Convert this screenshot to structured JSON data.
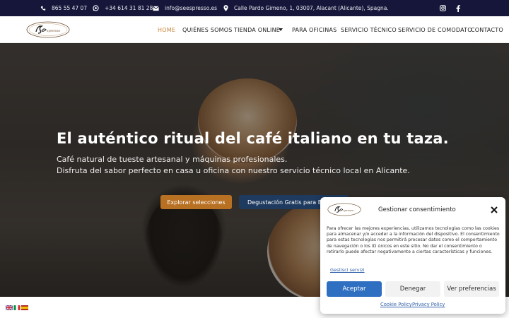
{
  "topbar": {
    "phone": "865 55 47 07",
    "whatsapp": "+34 614 31 81 28",
    "email": "info@seespresso.es",
    "address": "Calle Pardo Gimeno, 1, 03007, Alacant (Alicante), Spagna.",
    "social_icons": [
      "instagram-icon",
      "facebook-icon"
    ]
  },
  "nav": {
    "logo_text": "See spresso",
    "items": [
      {
        "label": "HOME",
        "active": true
      },
      {
        "label": "QUIÉNES SOMOS"
      },
      {
        "label": "TIENDA ONLINE"
      },
      {
        "label": "PARA OFICINAS"
      },
      {
        "label": "SERVICIO TÉCNICO"
      },
      {
        "label": "SERVICIO DE COMODATO"
      },
      {
        "label": "CONTACTO"
      }
    ]
  },
  "hero": {
    "headline": "El auténtico ritual del café italiano en tu taza.",
    "line1": "Café natural de tueste artesanal y máquinas profesionales.",
    "line2": "Disfruta del sabor perfecto en casa u oficina con nuestro servicio técnico local en Alicante.",
    "btn_primary": "Explorar selecciones",
    "btn_secondary": "Degustación Gratis para Empresas"
  },
  "languages": [
    "en",
    "it",
    "es"
  ],
  "consent": {
    "title": "Gestionar consentimiento",
    "text": "Para ofrecer las mejores experiencias, utilizamos tecnologías como las cookies para almacenar y/o acceder a la información del dispositivo. El consentimiento para estas tecnologías nos permitirá procesar datos como el comportamiento de navegación o los ID únicos en este sitio. No dar el consentimiento o retirarlo puede afectar negativamente a ciertas características y funciones.",
    "manage_link": "Gestisci servizi",
    "accept": "Aceptar",
    "deny": "Denegar",
    "preferences": "Ver preferencias",
    "cookie_policy": "Cookie Policy",
    "privacy_policy": "Privacy Policy"
  },
  "colors": {
    "topbar_bg": "#16163a",
    "accent": "#c9883e",
    "primary_btn": "#b87022",
    "secondary_btn": "#1e3a5f",
    "accept_btn": "#2f6fc1"
  }
}
